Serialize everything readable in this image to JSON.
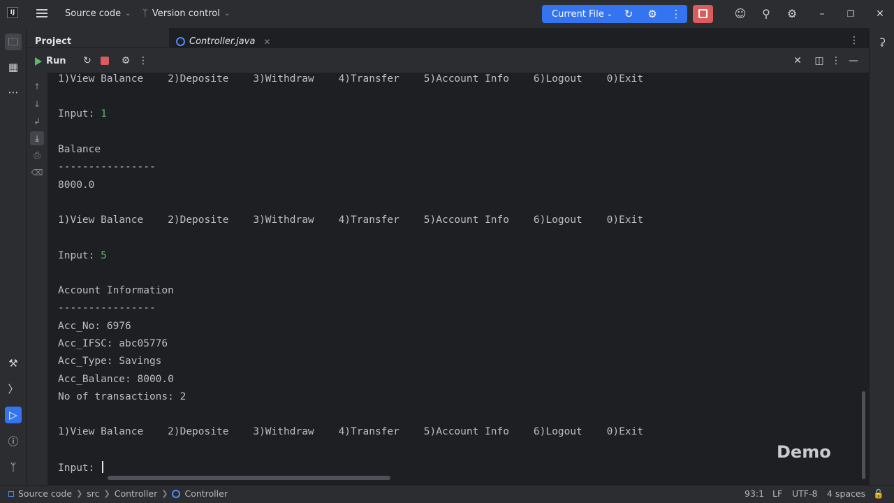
{
  "titlebar": {
    "project_menu": "Source code",
    "vcs_menu": "Version control",
    "run_config": "Current File"
  },
  "tool_window": {
    "project_title": "Project",
    "editor_tab": "Controller.java",
    "run_title": "Run"
  },
  "console": {
    "menu_line": "1)View Balance    2)Deposite    3)Withdraw    4)Transfer    5)Account Info    6)Logout    0)Exit",
    "input_label": "Input: ",
    "input1": "1",
    "balance_header": "Balance",
    "divider": "----------------",
    "balance_value": "8000.0",
    "input2": "5",
    "account_header": "Account Information",
    "acc_no": "Acc_No: 6976",
    "acc_ifsc": "Acc_IFSC: abc05776",
    "acc_type": "Acc_Type: Savings",
    "acc_balance": "Acc_Balance: 8000.0",
    "transactions": "No of transactions: 2"
  },
  "watermark": "Demo",
  "statusbar": {
    "crumbs": [
      "Source code",
      "src",
      "Controller",
      "Controller"
    ],
    "position": "93:1",
    "line_sep": "LF",
    "encoding": "UTF-8",
    "indent": "4 spaces"
  },
  "colors": {
    "accent": "#3574f0",
    "stop": "#db5c5c",
    "input_green": "#5fb865",
    "background": "#1e1f22",
    "panel": "#2b2d30"
  }
}
